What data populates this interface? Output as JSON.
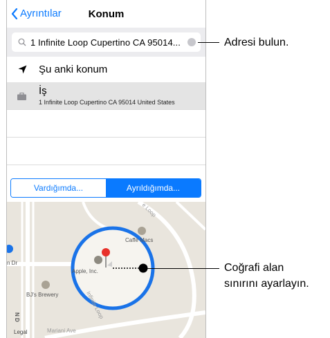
{
  "nav": {
    "back_label": "Ayrıntılar",
    "title": "Konum"
  },
  "search": {
    "value": "1 Infinite Loop Cupertino CA 95014..."
  },
  "list": {
    "current_location": "Şu anki konum",
    "work_title": "İş",
    "work_address": "1 Infinite Loop Cupertino CA 95014 United States"
  },
  "segment": {
    "options": [
      "Vardığımda...",
      "Ayrıldığımda..."
    ],
    "selected": "Ayrıldığımda..."
  },
  "map": {
    "labels": {
      "caffe": "Caffè Macs",
      "apple": "Apple, Inc.",
      "brewery": "BJ's Brewery",
      "mariani": "Mariani Ave",
      "nd": "N D",
      "dr": "n Dr",
      "legal": "Legal",
      "infinite": "Infinite Loop",
      "loop": "e Loop"
    }
  },
  "callouts": {
    "find_address": "Adresi bulun.",
    "geofence_line1": "Coğrafi alan",
    "geofence_line2": "sınırını ayarlayın."
  },
  "colors": {
    "accent": "#0a7aff",
    "pin": "#e8312a",
    "map_bg": "#e9e5dd",
    "circle_fill": "#f6f4ef"
  }
}
